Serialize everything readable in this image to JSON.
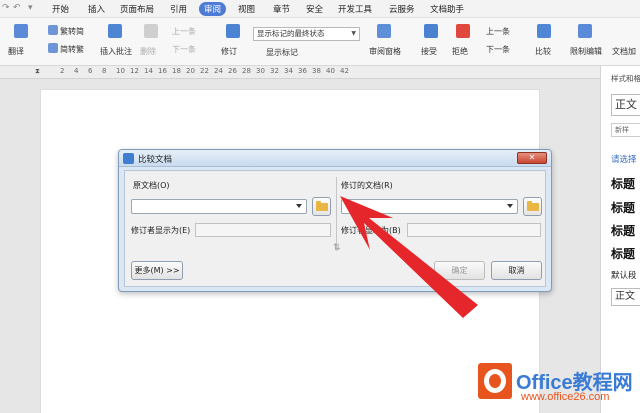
{
  "menubar": {
    "tabs": [
      "开始",
      "插入",
      "页面布局",
      "引用",
      "审阅",
      "视图",
      "章节",
      "安全",
      "开发工具",
      "云服务",
      "文档助手"
    ],
    "active_tab": "审阅"
  },
  "ribbon": {
    "translate": "翻译",
    "to_traditional": "繁转简",
    "to_simplified": "简转繁",
    "insert_comment": "插入批注",
    "delete": "删除",
    "prev_comment": "上一条",
    "next_comment": "下一条",
    "revise": "修订",
    "display_select": "显示标记的最终状态",
    "show_markup": "显示标记",
    "review_pane": "审阅窗格",
    "accept": "接受",
    "reject": "拒绝",
    "prev_change": "上一条",
    "next_change": "下一条",
    "compare": "比较",
    "restrict_edit": "限制编辑",
    "doc_encrypt": "文档加"
  },
  "ruler": {
    "numbers": [
      "2",
      "4",
      "6",
      "8",
      "10",
      "12",
      "14",
      "16",
      "18",
      "20",
      "22",
      "24",
      "26",
      "28",
      "30",
      "32",
      "34",
      "36",
      "38",
      "40",
      "42"
    ]
  },
  "side_panel": {
    "header": "样式和格",
    "style_box": "正文",
    "new_style": "新样",
    "select_label": "请选择",
    "headings": [
      "标题",
      "标题",
      "标题",
      "标题"
    ],
    "default": "默认段",
    "bottom_box": "正文"
  },
  "dialog": {
    "title": "比较文档",
    "original_label": "原文档(O)",
    "revised_label": "修订的文档(R)",
    "original_reviewer_label": "修订者显示为(E)",
    "revised_reviewer_label": "修订者显示为(B)",
    "more_button": "更多(M) >>",
    "ok_button": "确定",
    "cancel_button": "取消"
  },
  "watermark": {
    "brand": "Office教程网",
    "url": "www.office26.com"
  },
  "colors": {
    "accent": "#4e7bd6",
    "arrow": "#e5262a",
    "watermark_orange": "#e8541e",
    "watermark_blue": "#3a7bd5"
  }
}
